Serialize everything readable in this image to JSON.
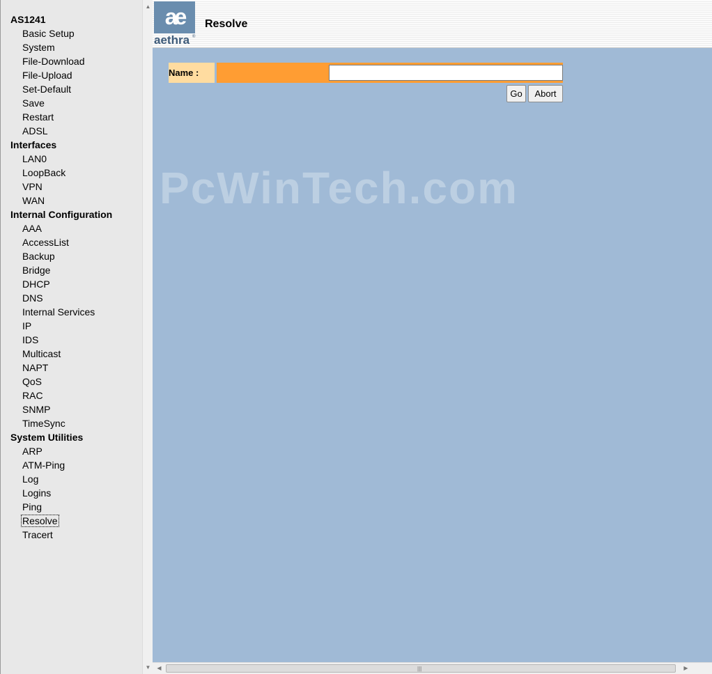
{
  "nav": {
    "sections": [
      {
        "title": "AS1241",
        "items": [
          "Basic Setup",
          "System",
          "File-Download",
          "File-Upload",
          "Set-Default",
          "Save",
          "Restart",
          "ADSL"
        ]
      },
      {
        "title": "Interfaces",
        "items": [
          "LAN0",
          "LoopBack",
          "VPN",
          "WAN"
        ]
      },
      {
        "title": "Internal Configuration",
        "items": [
          "AAA",
          "AccessList",
          "Backup",
          "Bridge",
          "DHCP",
          "DNS",
          "Internal Services",
          "IP",
          "IDS",
          "Multicast",
          "NAPT",
          "QoS",
          "RAC",
          "SNMP",
          "TimeSync"
        ]
      },
      {
        "title": "System Utilities",
        "items": [
          "ARP",
          "ATM-Ping",
          "Log",
          "Logins",
          "Ping",
          "Resolve",
          "Tracert"
        ]
      }
    ],
    "selected": "Resolve"
  },
  "header": {
    "logo_mark": "ae",
    "logo_word": "aethra",
    "logo_reg": "®",
    "title": "Resolve"
  },
  "form": {
    "name_label": "Name :",
    "name_value": "",
    "go_label": "Go",
    "abort_label": "Abort"
  },
  "watermark": "PcWinTech.com",
  "icons": {
    "scroll_up": "up-arrow-icon",
    "scroll_down": "down-arrow-icon",
    "scroll_left": "left-arrow-icon",
    "scroll_right": "right-arrow-icon"
  },
  "colors": {
    "main_bg": "#a0bad6",
    "field_bg": "#ff9d33",
    "label_bg": "#ffdca0",
    "logo_bg": "#6a8dae"
  }
}
